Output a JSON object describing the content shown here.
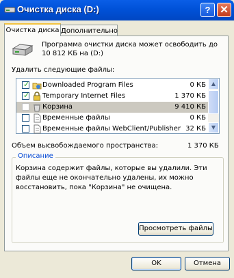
{
  "window": {
    "title": "Очистка диска  (D:)",
    "help_label": "?",
    "close_label": "✕"
  },
  "tabs": [
    {
      "label": "Очистка диска",
      "active": true
    },
    {
      "label": "Дополнительно",
      "active": false
    }
  ],
  "intro_text": "Программа очистки диска может освободить до 10 812 КБ на (D:)",
  "files_label": "Удалить следующие файлы:",
  "files": [
    {
      "name": "Downloaded Program Files",
      "size": "0 КБ",
      "checked": true,
      "selected": false
    },
    {
      "name": "Temporary Internet Files",
      "size": "1 370 КБ",
      "checked": true,
      "selected": false
    },
    {
      "name": "Корзина",
      "size": "9 410 КБ",
      "checked": false,
      "selected": true
    },
    {
      "name": "Временные файлы",
      "size": "0 КБ",
      "checked": false,
      "selected": false
    },
    {
      "name": "Временные файлы WebClient/Publisher",
      "size": "32 КБ",
      "checked": false,
      "selected": false
    }
  ],
  "space": {
    "label": "Объем высвобождаемого пространства:",
    "value": "1 370 КБ"
  },
  "description": {
    "title": "Описание",
    "text": "Корзина содержит файлы, которые вы удалили. Эти файлы еще не окончательно удалены, их можно восстановить, пока \"Корзина\" не очищена."
  },
  "buttons": {
    "view": "Просмотреть файлы",
    "ok": "OK",
    "cancel": "Отмена"
  },
  "colors": {
    "title_bar": "#0054e3",
    "selection": "#ccc9c0",
    "accent": "#0046d5"
  }
}
